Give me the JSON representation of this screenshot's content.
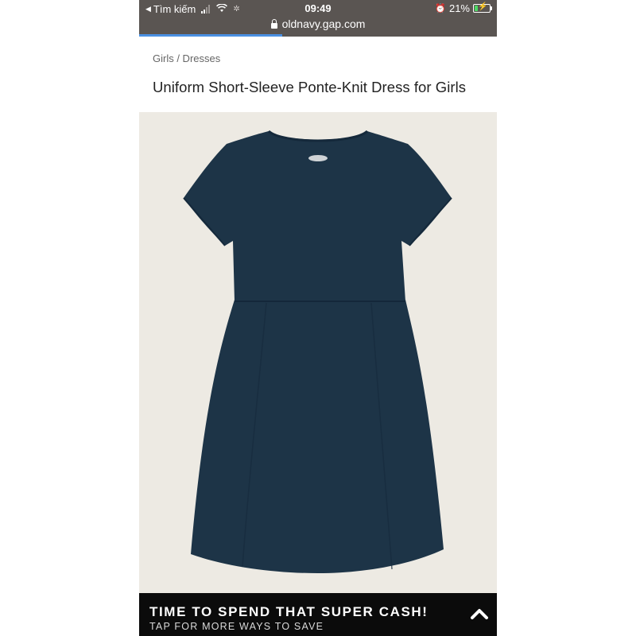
{
  "status_bar": {
    "back_label": "Tìm kiếm",
    "time": "09:49",
    "battery": "21%",
    "battery_level": 0.21,
    "signal_bars_on": 2,
    "signal_bars_total": 4
  },
  "browser": {
    "url": "oldnavy.gap.com",
    "load_progress": 0.4
  },
  "breadcrumb": "Girls / Dresses",
  "product": {
    "title": "Uniform Short-Sleeve Ponte-Knit Dress for Girls",
    "image_alt_icon": "navy-dress-image",
    "dress_color": "#1d3447",
    "background_color": "#edeae3"
  },
  "promo_banner": {
    "title": "TIME TO SPEND THAT SUPER CASH!",
    "subtitle": "TAP FOR MORE WAYS TO SAVE",
    "expand_icon": "chevron-up-icon"
  }
}
